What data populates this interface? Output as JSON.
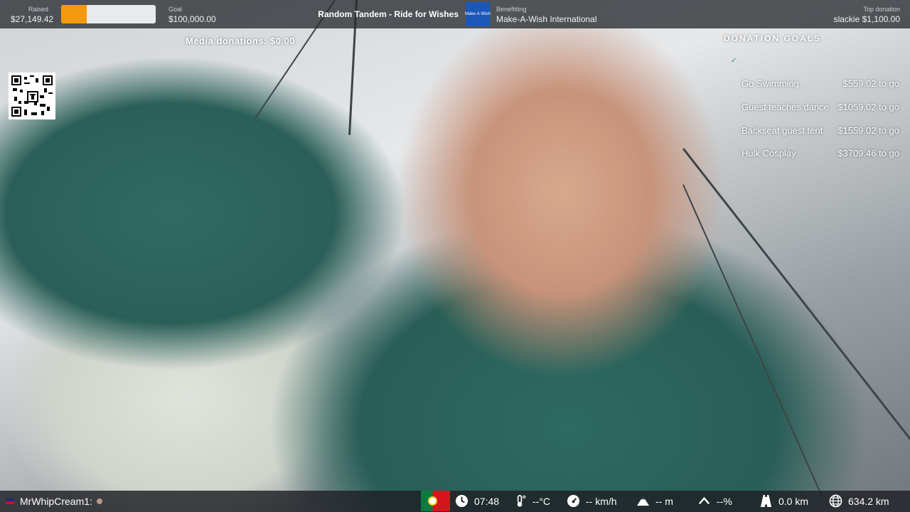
{
  "top_bar": {
    "raised_label": "Raised",
    "raised_value": "$27,149.42",
    "progress_fraction": 0.27,
    "goal_label": "Goal",
    "goal_value": "$100,000.00",
    "stream_title": "Random Tandem - Ride for Wishes",
    "charity_logo_text": "Make·A·Wish",
    "benefitting_label": "Benefitting",
    "benefitting_value": "Make-A-Wish International",
    "top_donation_label": "Top donation",
    "top_donation_value": "slackie $1,100.00"
  },
  "media_donations": "Media donations: $0.00",
  "donation_goals": {
    "title": "DONATION GOALS",
    "items": [
      {
        "name": "Go Swimming",
        "amount": "$559.02 to go"
      },
      {
        "name": "Guest teaches dance",
        "amount": "$1059.02 to go"
      },
      {
        "name": "Backseat guest tent",
        "amount": "$1559.02 to go"
      },
      {
        "name": "Hulk Cosplay",
        "amount": "$3709.46 to go"
      }
    ]
  },
  "bottom_bar": {
    "chat_user": "MrWhipCream1:",
    "time": "07:48",
    "temperature": "--°C",
    "speed": "-- km/h",
    "altitude": "-- m",
    "incline": "--%",
    "trip_distance": "0.0 km",
    "total_distance": "634.2 km"
  },
  "icons": [
    "qr-code-icon",
    "portugal-flag-icon",
    "clock-icon",
    "thermometer-icon",
    "speedometer-icon",
    "mountain-icon",
    "chevron-up-icon",
    "road-icon",
    "globe-icon"
  ],
  "colors": {
    "progress": "#f59a0f",
    "top_bar_bg": "#2c3034",
    "charity_blue": "#1b57b8"
  }
}
